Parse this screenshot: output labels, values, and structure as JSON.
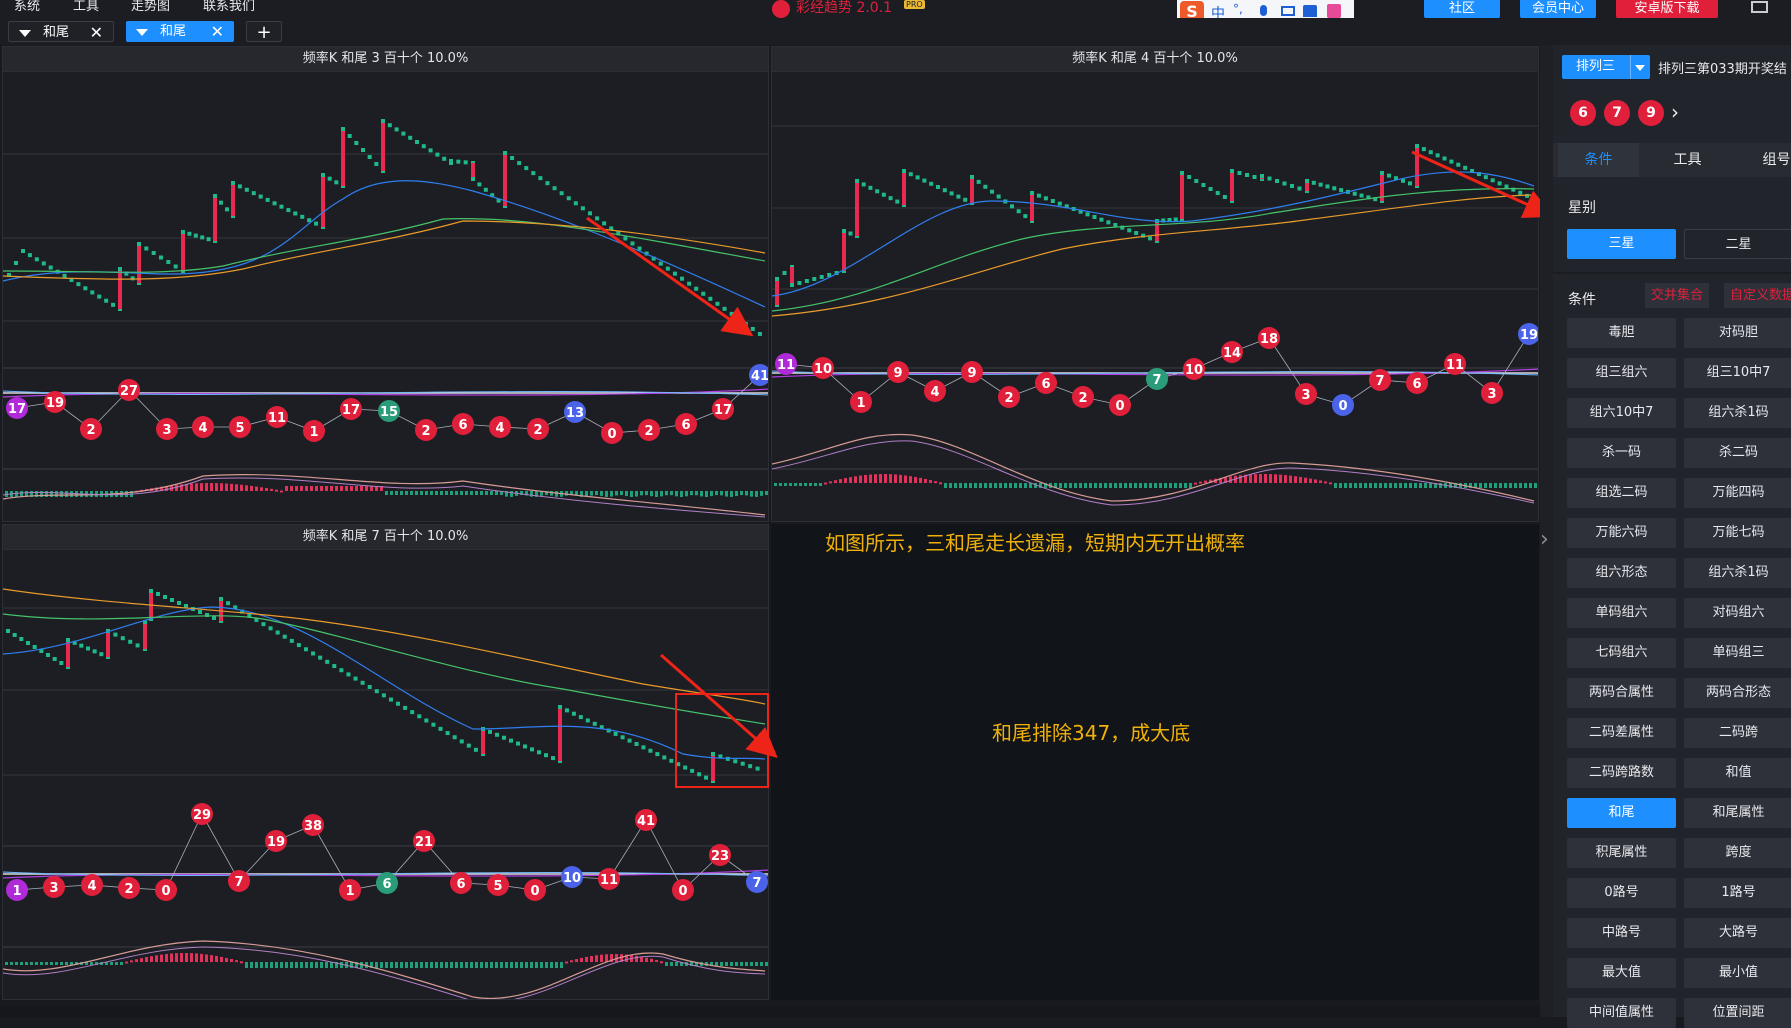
{
  "menu": [
    "系统",
    "工具",
    "走势图",
    "联系我们"
  ],
  "tabs": [
    {
      "label": "和尾",
      "active": false
    },
    {
      "label": "和尾",
      "active": true
    }
  ],
  "add_tab": "+",
  "app_title": "彩经趋势 2.0.1",
  "app_badge": "PRO",
  "ime_bar": [
    "中",
    "°,"
  ],
  "top_buttons": [
    {
      "label": "社区",
      "color": "#1e8fff"
    },
    {
      "label": "会员中心",
      "color": "#1e8fff"
    },
    {
      "label": "安卓版下载",
      "color": "#e0203a"
    }
  ],
  "panels": [
    {
      "title": "频率K  和尾  3  百十个  10.0%"
    },
    {
      "title": "频率K  和尾  4  百十个  10.0%"
    },
    {
      "title": "频率K  和尾  7  百十个  10.0%"
    }
  ],
  "panel1_balls": [
    {
      "v": "17",
      "c": "#b02ad8"
    },
    {
      "v": "19",
      "c": "#e0203a"
    },
    {
      "v": "2",
      "c": "#e0203a"
    },
    {
      "v": "27",
      "c": "#e0203a"
    },
    {
      "v": "3",
      "c": "#e0203a"
    },
    {
      "v": "4",
      "c": "#e0203a"
    },
    {
      "v": "5",
      "c": "#e0203a"
    },
    {
      "v": "11",
      "c": "#e0203a"
    },
    {
      "v": "1",
      "c": "#e0203a"
    },
    {
      "v": "17",
      "c": "#e0203a"
    },
    {
      "v": "15",
      "c": "#2a9c7a"
    },
    {
      "v": "2",
      "c": "#e0203a"
    },
    {
      "v": "6",
      "c": "#e0203a"
    },
    {
      "v": "4",
      "c": "#e0203a"
    },
    {
      "v": "2",
      "c": "#e0203a"
    },
    {
      "v": "13",
      "c": "#4a63e8"
    },
    {
      "v": "0",
      "c": "#e0203a"
    },
    {
      "v": "2",
      "c": "#e0203a"
    },
    {
      "v": "6",
      "c": "#e0203a"
    },
    {
      "v": "17",
      "c": "#e0203a"
    },
    {
      "v": "41",
      "c": "#4a63e8"
    }
  ],
  "panel2_balls": [
    {
      "v": "11",
      "c": "#b02ad8"
    },
    {
      "v": "10",
      "c": "#e0203a"
    },
    {
      "v": "1",
      "c": "#e0203a"
    },
    {
      "v": "9",
      "c": "#e0203a"
    },
    {
      "v": "4",
      "c": "#e0203a"
    },
    {
      "v": "9",
      "c": "#e0203a"
    },
    {
      "v": "2",
      "c": "#e0203a"
    },
    {
      "v": "6",
      "c": "#e0203a"
    },
    {
      "v": "2",
      "c": "#e0203a"
    },
    {
      "v": "0",
      "c": "#e0203a"
    },
    {
      "v": "7",
      "c": "#2a9c7a"
    },
    {
      "v": "10",
      "c": "#e0203a"
    },
    {
      "v": "14",
      "c": "#e0203a"
    },
    {
      "v": "18",
      "c": "#e0203a"
    },
    {
      "v": "3",
      "c": "#e0203a"
    },
    {
      "v": "0",
      "c": "#4a63e8"
    },
    {
      "v": "7",
      "c": "#e0203a"
    },
    {
      "v": "6",
      "c": "#e0203a"
    },
    {
      "v": "11",
      "c": "#e0203a"
    },
    {
      "v": "3",
      "c": "#e0203a"
    },
    {
      "v": "19",
      "c": "#4a63e8"
    }
  ],
  "panel3_balls": [
    {
      "v": "1",
      "c": "#b02ad8"
    },
    {
      "v": "3",
      "c": "#e0203a"
    },
    {
      "v": "4",
      "c": "#e0203a"
    },
    {
      "v": "2",
      "c": "#e0203a"
    },
    {
      "v": "0",
      "c": "#e0203a"
    },
    {
      "v": "29",
      "c": "#e0203a"
    },
    {
      "v": "7",
      "c": "#e0203a"
    },
    {
      "v": "19",
      "c": "#e0203a"
    },
    {
      "v": "38",
      "c": "#e0203a"
    },
    {
      "v": "1",
      "c": "#e0203a"
    },
    {
      "v": "6",
      "c": "#2a9c7a"
    },
    {
      "v": "21",
      "c": "#e0203a"
    },
    {
      "v": "6",
      "c": "#e0203a"
    },
    {
      "v": "5",
      "c": "#e0203a"
    },
    {
      "v": "0",
      "c": "#e0203a"
    },
    {
      "v": "10",
      "c": "#4a63e8"
    },
    {
      "v": "11",
      "c": "#e0203a"
    },
    {
      "v": "41",
      "c": "#e0203a"
    },
    {
      "v": "0",
      "c": "#e0203a"
    },
    {
      "v": "23",
      "c": "#e0203a"
    },
    {
      "v": "7",
      "c": "#4a63e8"
    }
  ],
  "annotations": {
    "note1": "如图所示，三和尾走长遗漏，短期内无开出概率",
    "note2": "和尾排除347，成大底"
  },
  "sidebar": {
    "select": "排列三",
    "issue_text": "排列三第033期开奖结",
    "balls": [
      "6",
      "7",
      "9"
    ],
    "tabs": [
      "条件",
      "工具",
      "组号"
    ],
    "section_star": "星别",
    "star_options": [
      "三星",
      "二星"
    ],
    "section_cond": "条件",
    "cond_links": [
      "交并集合",
      "自定义数据"
    ],
    "buttons": [
      "毒胆",
      "对码胆",
      "组三组六",
      "组三10中7",
      "组六10中7",
      "组六杀1码",
      "杀一码",
      "杀二码",
      "组选二码",
      "万能四码",
      "万能六码",
      "万能七码",
      "组六形态",
      "组六杀1码",
      "单码组六",
      "对码组六",
      "七码组六",
      "单码组三",
      "两码合属性",
      "两码合形态",
      "二码差属性",
      "二码跨",
      "二码跨路数",
      "和值",
      "和尾",
      "和尾属性",
      "积尾属性",
      "跨度",
      "0路号",
      "1路号",
      "中路号",
      "大路号",
      "最大值",
      "最小值",
      "中间值属性",
      "位置间距"
    ],
    "active_button": "和尾",
    "collapse_arrow": "›"
  },
  "colors": {
    "accent": "#1e8fff",
    "red": "#e0203a",
    "annotation": "#f0b20a",
    "teal": "#1fb98c"
  }
}
